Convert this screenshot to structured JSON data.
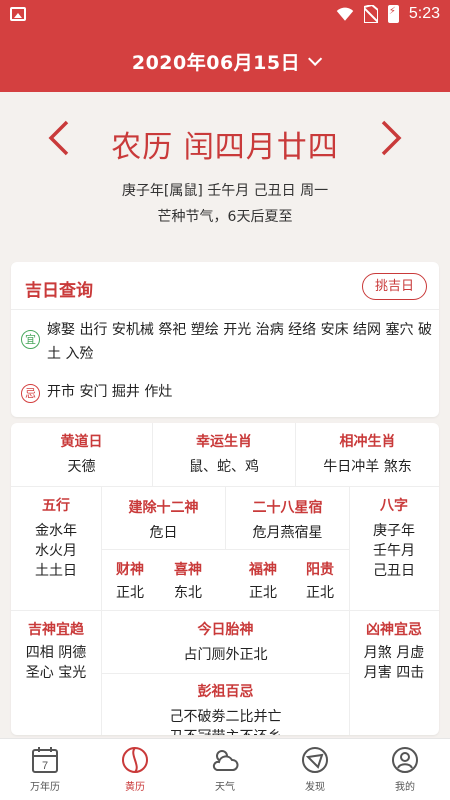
{
  "status_bar": {
    "time": "5:23"
  },
  "header": {
    "date": "2020年06月15日"
  },
  "lunar": {
    "title": "农历 闰四月廿四",
    "line1": "庚子年[属鼠]  壬午月  己丑日    周一",
    "line2": "芒种节气，6天后夏至"
  },
  "jiri": {
    "title": "吉日查询",
    "button": "挑吉日",
    "yi_badge": "宜",
    "yi_text": "嫁娶 出行 安机械 祭祀 塑绘 开光 治病 经络 安床 结网 塞穴 破土 入殓",
    "ji_badge": "忌",
    "ji_text": "开市 安门 掘井 作灶"
  },
  "grid": {
    "huangdao": {
      "label": "黄道日",
      "value": "天德"
    },
    "xingyun": {
      "label": "幸运生肖",
      "value": "鼠、蛇、鸡"
    },
    "xiangchong": {
      "label": "相冲生肖",
      "value": "牛日冲羊  煞东"
    },
    "wuxing": {
      "label": "五行",
      "v1": "金水年",
      "v2": "水火月",
      "v3": "土土日"
    },
    "jianchu": {
      "label": "建除十二神",
      "value": "危日"
    },
    "xiu": {
      "label": "二十八星宿",
      "value": "危月燕宿星"
    },
    "bazi": {
      "label": "八字",
      "v1": "庚子年",
      "v2": "壬午月",
      "v3": "己丑日"
    },
    "caishen": {
      "label": "财神",
      "value": "正北"
    },
    "xishen": {
      "label": "喜神",
      "value": "东北"
    },
    "fushen": {
      "label": "福神",
      "value": "正北"
    },
    "yanggui": {
      "label": "阳贵",
      "value": "正北"
    },
    "jishen": {
      "label": "吉神宜趋",
      "v1": "四相 阴德",
      "v2": "圣心 宝光"
    },
    "taishen": {
      "label": "今日胎神",
      "value": "占门厕外正北"
    },
    "xiongshen": {
      "label": "凶神宜忌",
      "v1": "月煞 月虚",
      "v2": "月害 四击"
    },
    "pengzu": {
      "label": "彭祖百忌",
      "v1": "己不破劵二比并亡",
      "v2": "丑不冠带主不还乡"
    }
  },
  "tabs": [
    {
      "label": "万年历",
      "icon": "calendar-icon"
    },
    {
      "label": "黄历",
      "icon": "yinyang-icon"
    },
    {
      "label": "天气",
      "icon": "weather-icon"
    },
    {
      "label": "发现",
      "icon": "discover-icon"
    },
    {
      "label": "我的",
      "icon": "profile-icon"
    }
  ],
  "calendar_icon_day": "7",
  "colors": {
    "primary": "#d44040",
    "accent_text": "#c93a3a",
    "green": "#4aa85e"
  }
}
